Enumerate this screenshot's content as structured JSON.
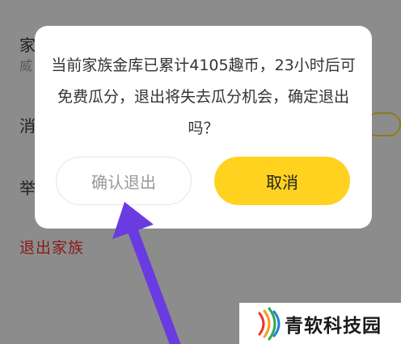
{
  "background": {
    "row1_label": "家",
    "row1_sub": "威",
    "row2_label": "消",
    "row3_label": "举",
    "exit_family": "退出家族"
  },
  "dialog": {
    "message": "当前家族金库已累计4105趣币，23小时后可免费瓜分，退出将失去瓜分机会，确定退出吗？",
    "confirm_label": "确认退出",
    "cancel_label": "取消"
  },
  "watermark": {
    "text": "青软科技园",
    "logo": "colorful-arc-logo"
  },
  "colors": {
    "overlay": "#8c8c8c",
    "accent_yellow": "#ffd21f",
    "arrow_purple": "#6a3be0",
    "danger_text": "#8a1a1a"
  }
}
